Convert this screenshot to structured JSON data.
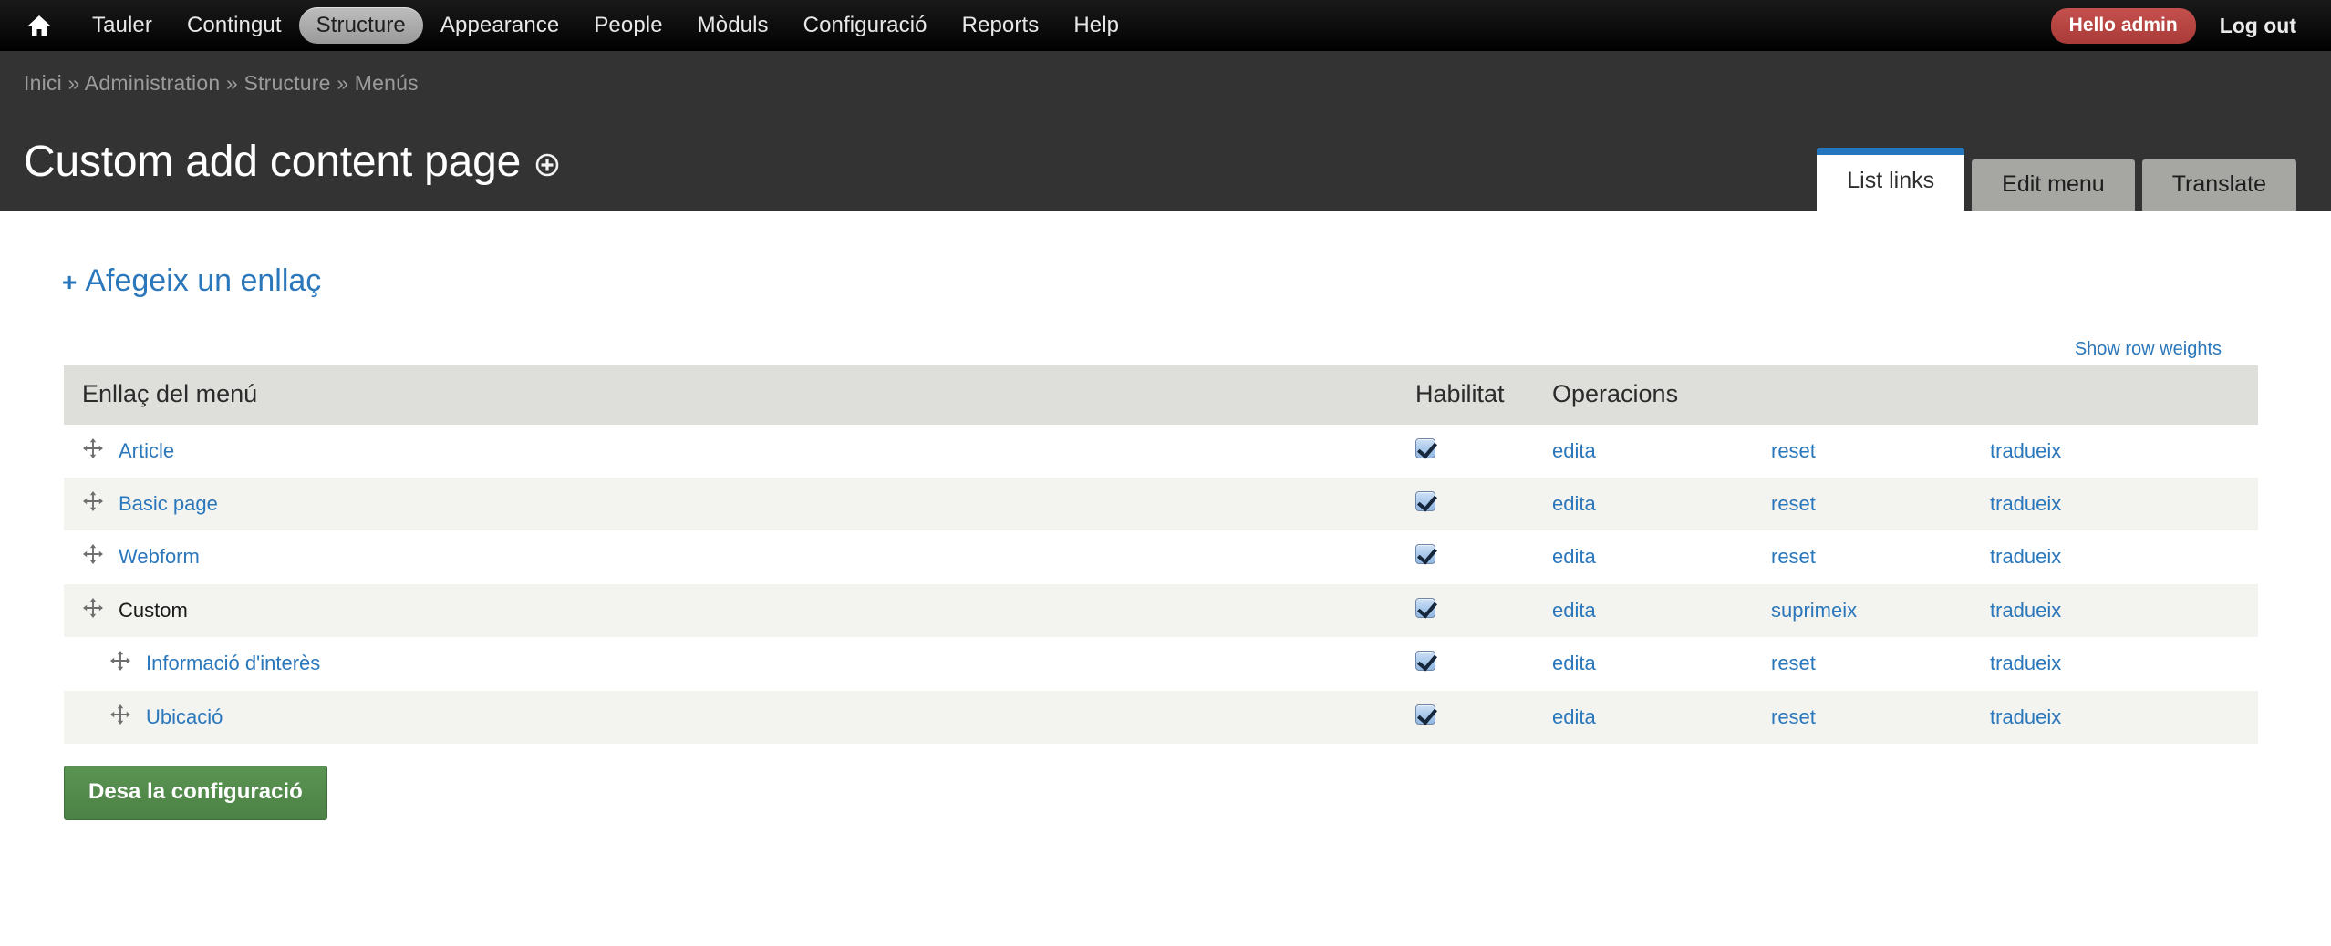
{
  "toolbar": {
    "home_icon": "home-icon",
    "items": [
      {
        "label": "Tauler",
        "active": false
      },
      {
        "label": "Contingut",
        "active": false
      },
      {
        "label": "Structure",
        "active": true
      },
      {
        "label": "Appearance",
        "active": false
      },
      {
        "label": "People",
        "active": false
      },
      {
        "label": "Mòduls",
        "active": false
      },
      {
        "label": "Configuració",
        "active": false
      },
      {
        "label": "Reports",
        "active": false
      },
      {
        "label": "Help",
        "active": false
      }
    ],
    "hello_badge": "Hello admin",
    "logout": "Log out"
  },
  "header": {
    "breadcrumb": "Inici » Administration » Structure » Menús",
    "title": "Custom add content page",
    "title_icon": "plus-circle-icon"
  },
  "tabs": [
    {
      "label": "List links",
      "active": true
    },
    {
      "label": "Edit menu",
      "active": false
    },
    {
      "label": "Translate",
      "active": false
    }
  ],
  "main": {
    "add_link_plus": "+",
    "add_link_label": "Afegeix un enllaç",
    "show_row_weights": "Show row weights",
    "save_button": "Desa la configuració"
  },
  "table": {
    "columns": [
      "Enllaç del menú",
      "Habilitat",
      "Operacions",
      "",
      ""
    ],
    "rows": [
      {
        "label": "Article",
        "is_link": true,
        "indent": 0,
        "enabled": true,
        "ops": [
          "edita",
          "reset",
          "tradueix"
        ]
      },
      {
        "label": "Basic page",
        "is_link": true,
        "indent": 0,
        "enabled": true,
        "ops": [
          "edita",
          "reset",
          "tradueix"
        ]
      },
      {
        "label": "Webform",
        "is_link": true,
        "indent": 0,
        "enabled": true,
        "ops": [
          "edita",
          "reset",
          "tradueix"
        ]
      },
      {
        "label": "Custom",
        "is_link": false,
        "indent": 0,
        "enabled": true,
        "ops": [
          "edita",
          "suprimeix",
          "tradueix"
        ]
      },
      {
        "label": "Informació d'interès",
        "is_link": true,
        "indent": 1,
        "enabled": true,
        "ops": [
          "edita",
          "reset",
          "tradueix"
        ]
      },
      {
        "label": "Ubicació",
        "is_link": true,
        "indent": 1,
        "enabled": true,
        "ops": [
          "edita",
          "reset",
          "tradueix"
        ]
      }
    ]
  },
  "colors": {
    "toolbar_bg": "#0d0d0d",
    "header_bg": "#333333",
    "accent_link": "#2a77bb",
    "tab_active_border": "#2176bd",
    "badge_red": "#b9433f",
    "save_green": "#52874b",
    "table_header_bg": "#dededa",
    "row_alt_bg": "#f3f3ef"
  }
}
